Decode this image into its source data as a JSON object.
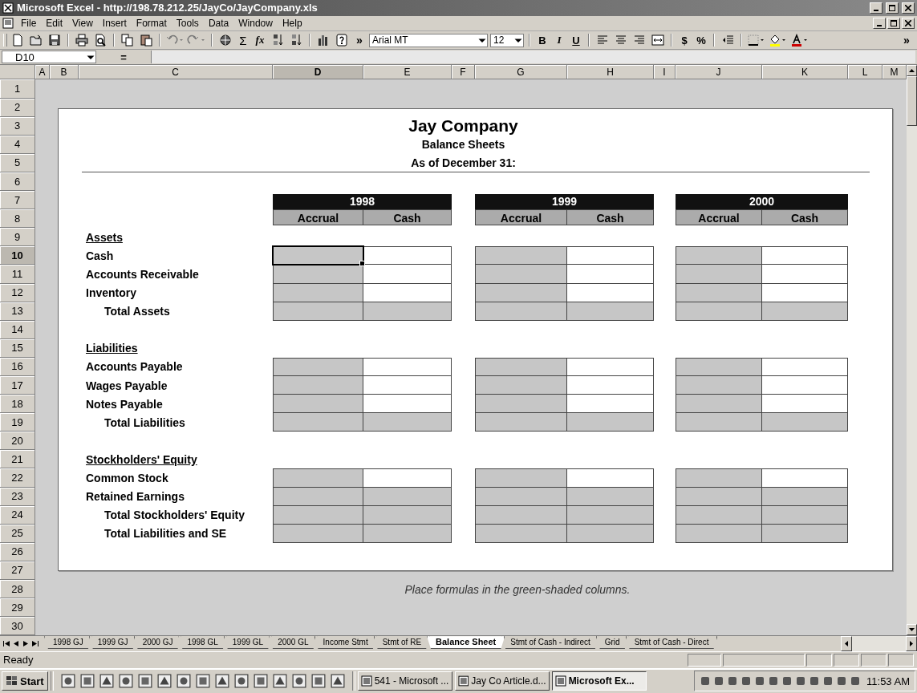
{
  "window": {
    "title": "Microsoft Excel - http://198.78.212.25/JayCo/JayCompany.xls"
  },
  "menu": [
    "File",
    "Edit",
    "View",
    "Insert",
    "Format",
    "Tools",
    "Data",
    "Window",
    "Help"
  ],
  "toolbar": {
    "autosum": "Σ",
    "function": "fx",
    "more": "»",
    "font": "Arial MT",
    "size": "12",
    "bold": "B",
    "italic": "I",
    "underline": "U",
    "currency": "$",
    "percent": "%",
    "more_right": "»"
  },
  "formula_bar": {
    "name_box": "D10",
    "equals": "="
  },
  "columns": [
    {
      "label": "A",
      "selected": false
    },
    {
      "label": "B",
      "selected": false
    },
    {
      "label": "C",
      "selected": false
    },
    {
      "label": "D",
      "selected": true
    },
    {
      "label": "E",
      "selected": false
    },
    {
      "label": "F",
      "selected": false
    },
    {
      "label": "G",
      "selected": false
    },
    {
      "label": "H",
      "selected": false
    },
    {
      "label": "I",
      "selected": false
    },
    {
      "label": "J",
      "selected": false
    },
    {
      "label": "K",
      "selected": false
    },
    {
      "label": "L",
      "selected": false
    },
    {
      "label": "M",
      "selected": false
    }
  ],
  "rows": [
    {
      "label": "1",
      "selected": false
    },
    {
      "label": "2",
      "selected": false
    },
    {
      "label": "3",
      "selected": false
    },
    {
      "label": "4",
      "selected": false
    },
    {
      "label": "5",
      "selected": false
    },
    {
      "label": "6",
      "selected": false
    },
    {
      "label": "7",
      "selected": false
    },
    {
      "label": "8",
      "selected": false
    },
    {
      "label": "9",
      "selected": false
    },
    {
      "label": "10",
      "selected": true
    },
    {
      "label": "11",
      "selected": false
    },
    {
      "label": "12",
      "selected": false
    },
    {
      "label": "13",
      "selected": false
    },
    {
      "label": "14",
      "selected": false
    },
    {
      "label": "15",
      "selected": false
    },
    {
      "label": "16",
      "selected": false
    },
    {
      "label": "17",
      "selected": false
    },
    {
      "label": "18",
      "selected": false
    },
    {
      "label": "19",
      "selected": false
    },
    {
      "label": "20",
      "selected": false
    },
    {
      "label": "21",
      "selected": false
    },
    {
      "label": "22",
      "selected": false
    },
    {
      "label": "23",
      "selected": false
    },
    {
      "label": "24",
      "selected": false
    },
    {
      "label": "25",
      "selected": false
    },
    {
      "label": "26",
      "selected": false
    },
    {
      "label": "27",
      "selected": false
    },
    {
      "label": "28",
      "selected": false
    },
    {
      "label": "29",
      "selected": false
    },
    {
      "label": "30",
      "selected": false
    }
  ],
  "report": {
    "title": "Jay Company",
    "subtitle": "Balance Sheets",
    "date_line": "As of December 31:",
    "years": [
      {
        "year": "1998",
        "columns": [
          "Accrual",
          "Cash"
        ]
      },
      {
        "year": "1999",
        "columns": [
          "Accrual",
          "Cash"
        ]
      },
      {
        "year": "2000",
        "columns": [
          "Accrual",
          "Cash"
        ]
      }
    ],
    "sections": [
      {
        "heading": "Assets",
        "lines": [
          {
            "label": "Cash",
            "kind": "item",
            "cash_shaded": false
          },
          {
            "label": "Accounts Receivable",
            "kind": "item",
            "cash_shaded": false
          },
          {
            "label": "Inventory",
            "kind": "item",
            "cash_shaded": false
          },
          {
            "label": "Total Assets",
            "kind": "total",
            "cash_shaded": true
          }
        ]
      },
      {
        "heading": "Liabilities",
        "lines": [
          {
            "label": "Accounts Payable",
            "kind": "item",
            "cash_shaded": false
          },
          {
            "label": "Wages Payable",
            "kind": "item",
            "cash_shaded": false
          },
          {
            "label": "Notes Payable",
            "kind": "item",
            "cash_shaded": false
          },
          {
            "label": "Total Liabilities",
            "kind": "total",
            "cash_shaded": true
          }
        ]
      },
      {
        "heading": "Stockholders' Equity",
        "lines": [
          {
            "label": "Common Stock",
            "kind": "item",
            "cash_shaded": false
          },
          {
            "label": "Retained Earnings",
            "kind": "item",
            "cash_shaded": true
          },
          {
            "label": "Total Stockholders' Equity",
            "kind": "total",
            "cash_shaded": true
          },
          {
            "label": "Total Liabilities and SE",
            "kind": "total",
            "cash_shaded": true
          }
        ]
      }
    ]
  },
  "note": "Place formulas in the green-shaded columns.",
  "sheet_tabs": [
    {
      "label": "1998 GJ",
      "selected": false
    },
    {
      "label": "1999 GJ",
      "selected": false
    },
    {
      "label": "2000 GJ",
      "selected": false
    },
    {
      "label": "1998 GL",
      "selected": false
    },
    {
      "label": "1999 GL",
      "selected": false
    },
    {
      "label": "2000 GL",
      "selected": false
    },
    {
      "label": "Income Stmt",
      "selected": false
    },
    {
      "label": "Stmt of RE",
      "selected": false
    },
    {
      "label": "Balance Sheet",
      "selected": true
    },
    {
      "label": "Stmt of Cash - Indirect",
      "selected": false
    },
    {
      "label": "Grid",
      "selected": false
    },
    {
      "label": "Stmt of Cash - Direct",
      "selected": false
    }
  ],
  "status_bar": {
    "text": "Ready"
  },
  "taskbar": {
    "start": "Start",
    "tasks": [
      {
        "label": "541 - Microsoft ...",
        "selected": false
      },
      {
        "label": "Jay Co Article.d...",
        "selected": false
      },
      {
        "label": "Microsoft Ex...",
        "selected": true
      }
    ],
    "clock": "11:53 AM"
  }
}
